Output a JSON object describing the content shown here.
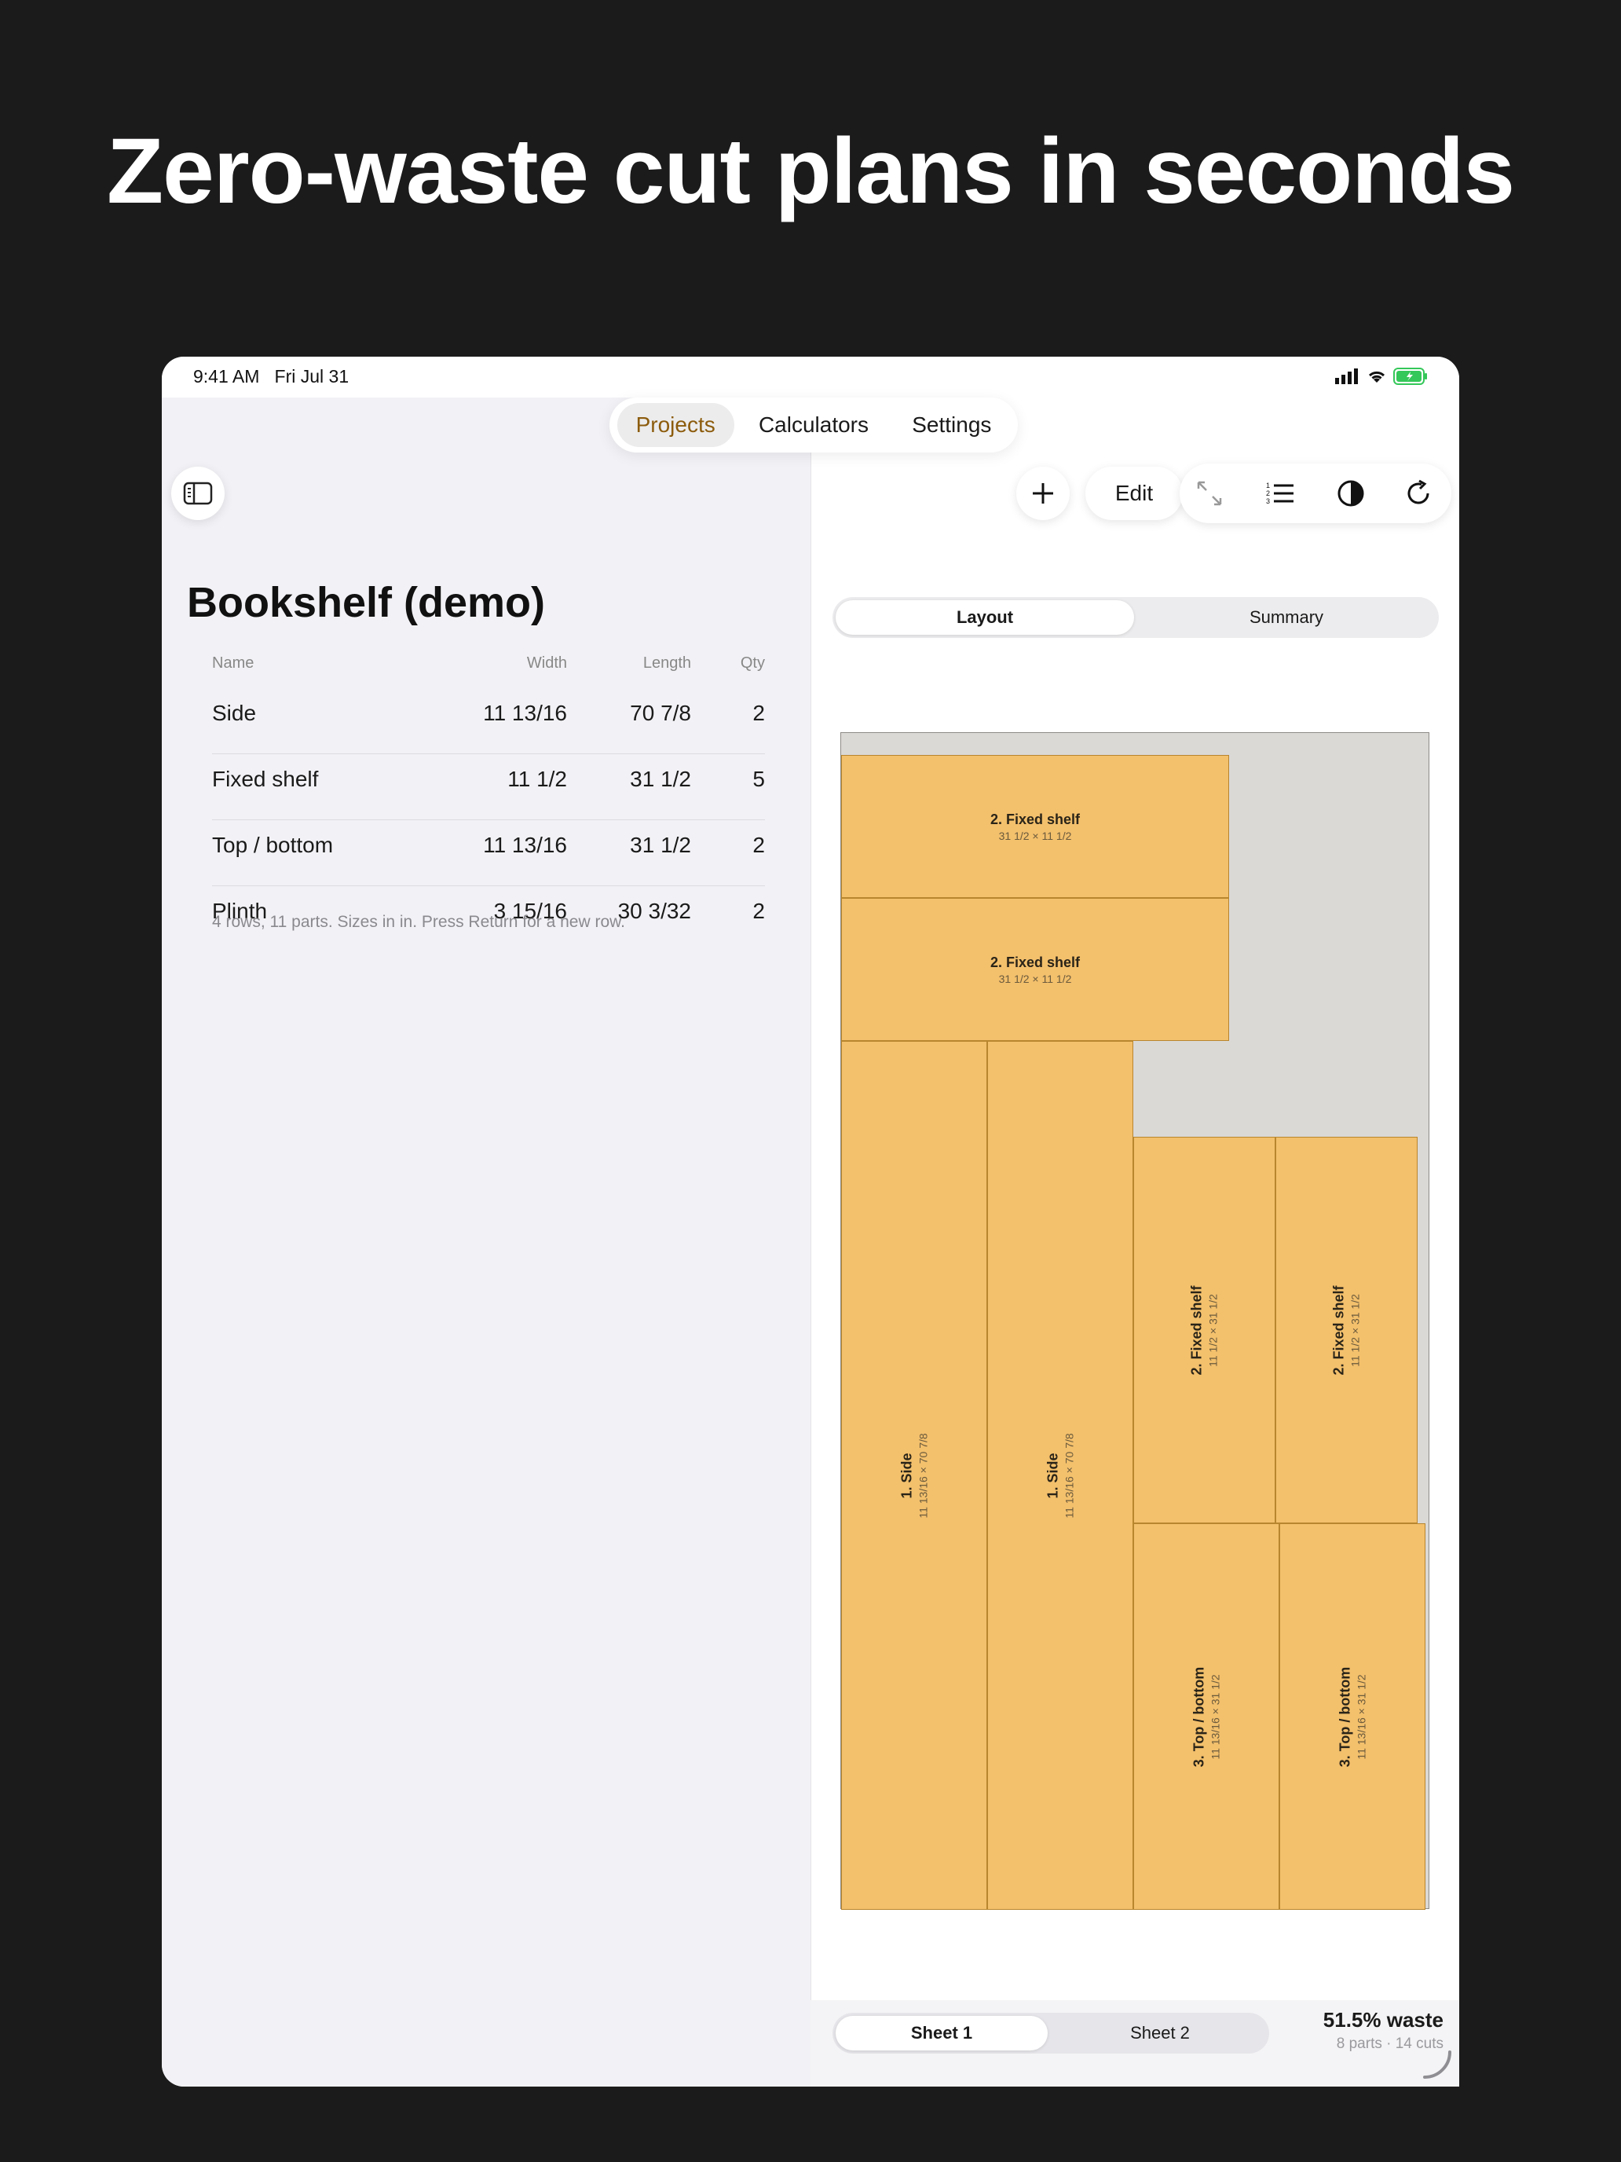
{
  "headline": "Zero-waste cut plans in seconds",
  "status": {
    "time": "9:41 AM   Fri Jul 31"
  },
  "nav": {
    "tabs": [
      {
        "label": "Projects",
        "active": true
      },
      {
        "label": "Calculators"
      },
      {
        "label": "Settings"
      }
    ]
  },
  "toolbar": {
    "edit_label": "Edit",
    "icons": [
      "sidebar-toggle-icon",
      "plus-icon",
      "expand-icon",
      "numbered-list-icon",
      "contrast-icon",
      "refresh-icon"
    ]
  },
  "project": {
    "title": "Bookshelf (demo)",
    "columns": {
      "name": "Name",
      "width": "Width",
      "length": "Length",
      "qty": "Qty"
    },
    "rows": [
      {
        "name": "Side",
        "width": "11 13/16",
        "length": "70 7/8",
        "qty": "2"
      },
      {
        "name": "Fixed shelf",
        "width": "11 1/2",
        "length": "31 1/2",
        "qty": "5"
      },
      {
        "name": "Top / bottom",
        "width": "11 13/16",
        "length": "31 1/2",
        "qty": "2"
      },
      {
        "name": "Plinth",
        "width": "3 15/16",
        "length": "30 3/32",
        "qty": "2"
      }
    ],
    "note": "4 rows, 11 parts. Sizes in in. Press Return for a new row."
  },
  "view_tabs": [
    {
      "label": "Layout",
      "active": true
    },
    {
      "label": "Summary"
    }
  ],
  "layout": {
    "parts": [
      {
        "name": "2. Fixed shelf",
        "dims": "31 1/2 × 11 1/2"
      },
      {
        "name": "2. Fixed shelf",
        "dims": "31 1/2 × 11 1/2"
      },
      {
        "name": "1. Side",
        "dims": "11 13/16 × 70 7/8"
      },
      {
        "name": "1. Side",
        "dims": "11 13/16 × 70 7/8"
      },
      {
        "name": "2. Fixed shelf",
        "dims": "11 1/2 × 31 1/2"
      },
      {
        "name": "2. Fixed shelf",
        "dims": "11 1/2 × 31 1/2"
      },
      {
        "name": "3. Top / bottom",
        "dims": "11 13/16 × 31 1/2"
      },
      {
        "name": "3. Top / bottom",
        "dims": "11 13/16 × 31 1/2"
      }
    ]
  },
  "sheets": [
    {
      "label": "Sheet 1",
      "active": true
    },
    {
      "label": "Sheet 2"
    }
  ],
  "summary": {
    "waste": "51.5% waste",
    "detail": "8 parts · 14 cuts"
  },
  "colors": {
    "accent": "#8c5c0d",
    "part_fill": "#f3c06c",
    "sheet_bg": "#dbd9d6"
  }
}
